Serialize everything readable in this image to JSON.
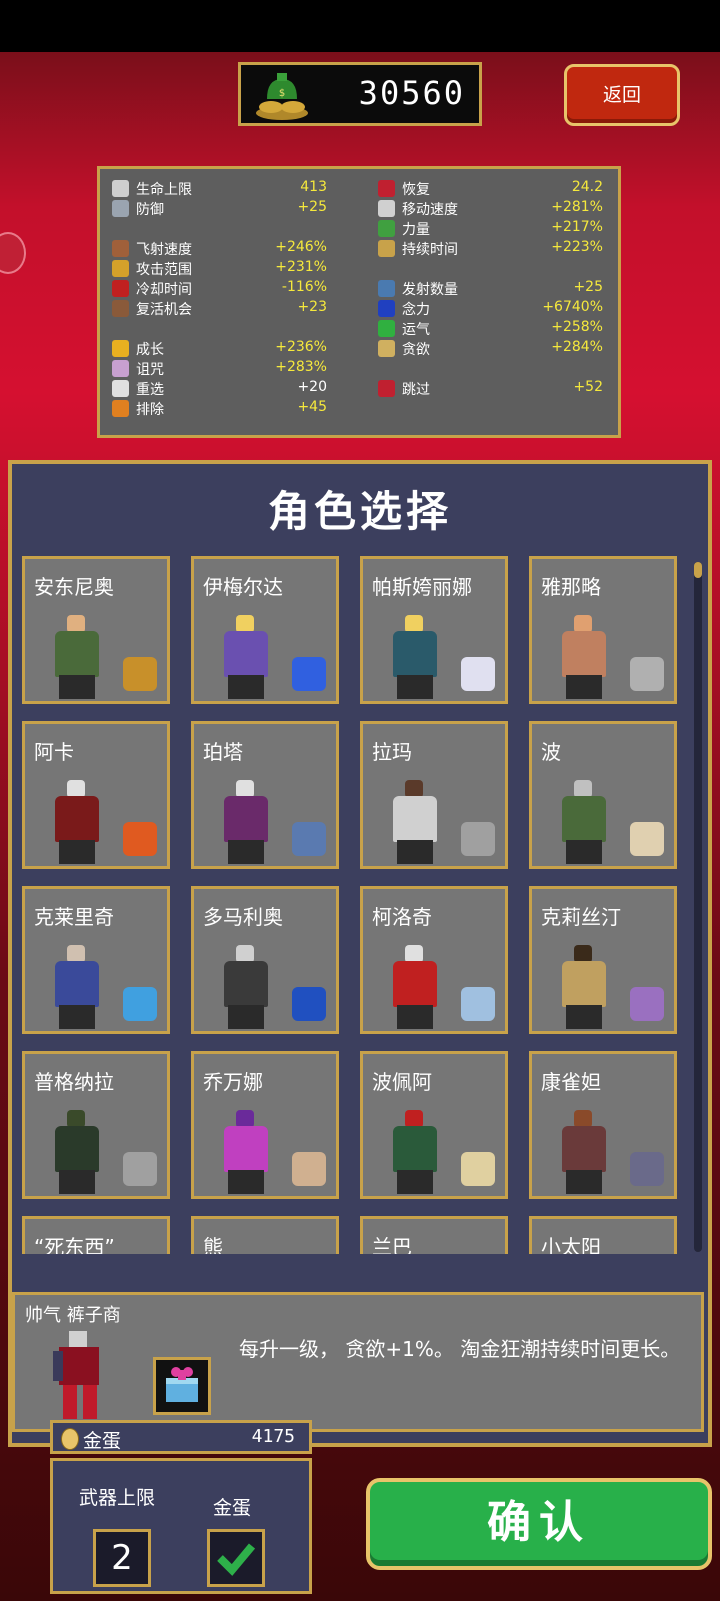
{
  "coins": {
    "value": "30560"
  },
  "back_button": {
    "label": "返回"
  },
  "stats": {
    "left": [
      {
        "label": "生命上限",
        "value": "413",
        "icon_color": "#cfcfcf",
        "white": false,
        "row": 0
      },
      {
        "label": "防御",
        "value": "+25",
        "icon_color": "#9aa4b0",
        "white": false,
        "row": 1
      },
      {
        "label": "飞射速度",
        "value": "+246%",
        "icon_color": "#a0603a",
        "white": false,
        "row": 3
      },
      {
        "label": "攻击范围",
        "value": "+231%",
        "icon_color": "#d4a12a",
        "white": false,
        "row": 4
      },
      {
        "label": "冷却时间",
        "value": "-116%",
        "icon_color": "#c02020",
        "white": false,
        "row": 5
      },
      {
        "label": "复活机会",
        "value": "+23",
        "icon_color": "#8a5a3a",
        "white": false,
        "row": 6
      },
      {
        "label": "成长",
        "value": "+236%",
        "icon_color": "#e8b020",
        "white": false,
        "row": 8
      },
      {
        "label": "诅咒",
        "value": "+283%",
        "icon_color": "#c8a0d0",
        "white": false,
        "row": 9
      },
      {
        "label": "重选",
        "value": "+20",
        "icon_color": "#e0e0e0",
        "white": true,
        "row": 10
      },
      {
        "label": "排除",
        "value": "+45",
        "icon_color": "#e08020",
        "white": false,
        "row": 11
      }
    ],
    "right": [
      {
        "label": "恢复",
        "value": "24.2",
        "icon_color": "#c02030",
        "white": false,
        "row": 0
      },
      {
        "label": "移动速度",
        "value": "+281%",
        "icon_color": "#d0d0d0",
        "white": false,
        "row": 1
      },
      {
        "label": "力量",
        "value": "+217%",
        "icon_color": "#40a040",
        "white": false,
        "row": 2
      },
      {
        "label": "持续时间",
        "value": "+223%",
        "icon_color": "#c8a24a",
        "white": false,
        "row": 3
      },
      {
        "label": "发射数量",
        "value": "+25",
        "icon_color": "#4a7ab0",
        "white": false,
        "row": 5
      },
      {
        "label": "念力",
        "value": "+6740%",
        "icon_color": "#2040c0",
        "white": false,
        "row": 6
      },
      {
        "label": "运气",
        "value": "+258%",
        "icon_color": "#30b040",
        "white": false,
        "row": 7
      },
      {
        "label": "贪欲",
        "value": "+284%",
        "icon_color": "#d0b060",
        "white": false,
        "row": 8
      },
      {
        "label": "跳过",
        "value": "+52",
        "icon_color": "#c02030",
        "white": false,
        "row": 10
      }
    ]
  },
  "panel": {
    "title": "角色选择"
  },
  "characters": [
    {
      "name": "安东尼奥",
      "head": "#e0b080",
      "body": "#4a6a3a",
      "item": "#c8902a"
    },
    {
      "name": "伊梅尔达",
      "head": "#f0d060",
      "body": "#6a50b0",
      "item": "#3060e0"
    },
    {
      "name": "帕斯姱丽娜",
      "head": "#f0d060",
      "body": "#2a5a6a",
      "item": "#e0e0f0"
    },
    {
      "name": "雅那略",
      "head": "#e0a070",
      "body": "#c08060",
      "item": "#b0b0b0"
    },
    {
      "name": "阿卡",
      "head": "#e0e0e0",
      "body": "#7a1a1a",
      "item": "#e05a20"
    },
    {
      "name": "珀塔",
      "head": "#e0e0e0",
      "body": "#6a2a6a",
      "item": "#5a7ab0"
    },
    {
      "name": "拉玛",
      "head": "#5a3a2a",
      "body": "#d0d0d0",
      "item": "#a0a0a0"
    },
    {
      "name": "波",
      "head": "#c0c0c0",
      "body": "#4a6a3a",
      "item": "#e0d0b0"
    },
    {
      "name": "克莱里奇",
      "head": "#d0c0b0",
      "body": "#3a4a9a",
      "item": "#40a0e0"
    },
    {
      "name": "多马利奥",
      "head": "#d0d0d0",
      "body": "#3a3a3a",
      "item": "#2050c0"
    },
    {
      "name": "柯洛奇",
      "head": "#e0e0e0",
      "body": "#c02020",
      "item": "#a0c0e0"
    },
    {
      "name": "克莉丝汀",
      "head": "#3a2a1a",
      "body": "#c0a060",
      "item": "#9a70c0"
    },
    {
      "name": "普格纳拉",
      "head": "#3a4a2a",
      "body": "#2a3a2a",
      "item": "#a0a0a0"
    },
    {
      "name": "乔万娜",
      "head": "#6a2a9a",
      "body": "#c040c0",
      "item": "#d0b090"
    },
    {
      "name": "波佩阿",
      "head": "#c02020",
      "body": "#2a5a3a",
      "item": "#e0d0a0"
    },
    {
      "name": "康雀妲",
      "head": "#8a4a2a",
      "body": "#6a3a3a",
      "item": "#6a6a8a"
    },
    {
      "name": "“死东西”",
      "head": "#e0c030",
      "body": "#5a5a5a",
      "item": "#5a5a5a"
    },
    {
      "name": "熊",
      "head": "#6a4a2a",
      "body": "#6a4a2a",
      "item": "#6a6a6a"
    },
    {
      "name": "兰巴",
      "head": "#c0a080",
      "body": "#5a5a5a",
      "item": "#6a6a6a"
    },
    {
      "name": "小太阳",
      "head": "#e0c030",
      "body": "#5a5a5a",
      "item": "#6a6a6a"
    }
  ],
  "selected": {
    "name": "帅气 裤子商",
    "description": "每升一级， 贪欲+1%。 淘金狂潮持续时间更长。"
  },
  "eggs": {
    "label": "金蛋",
    "value": "4175"
  },
  "options": {
    "weapon_limit_label": "武器上限",
    "weapon_limit_value": "2",
    "golden_egg_label": "金蛋"
  },
  "confirm": {
    "label": "确认"
  }
}
